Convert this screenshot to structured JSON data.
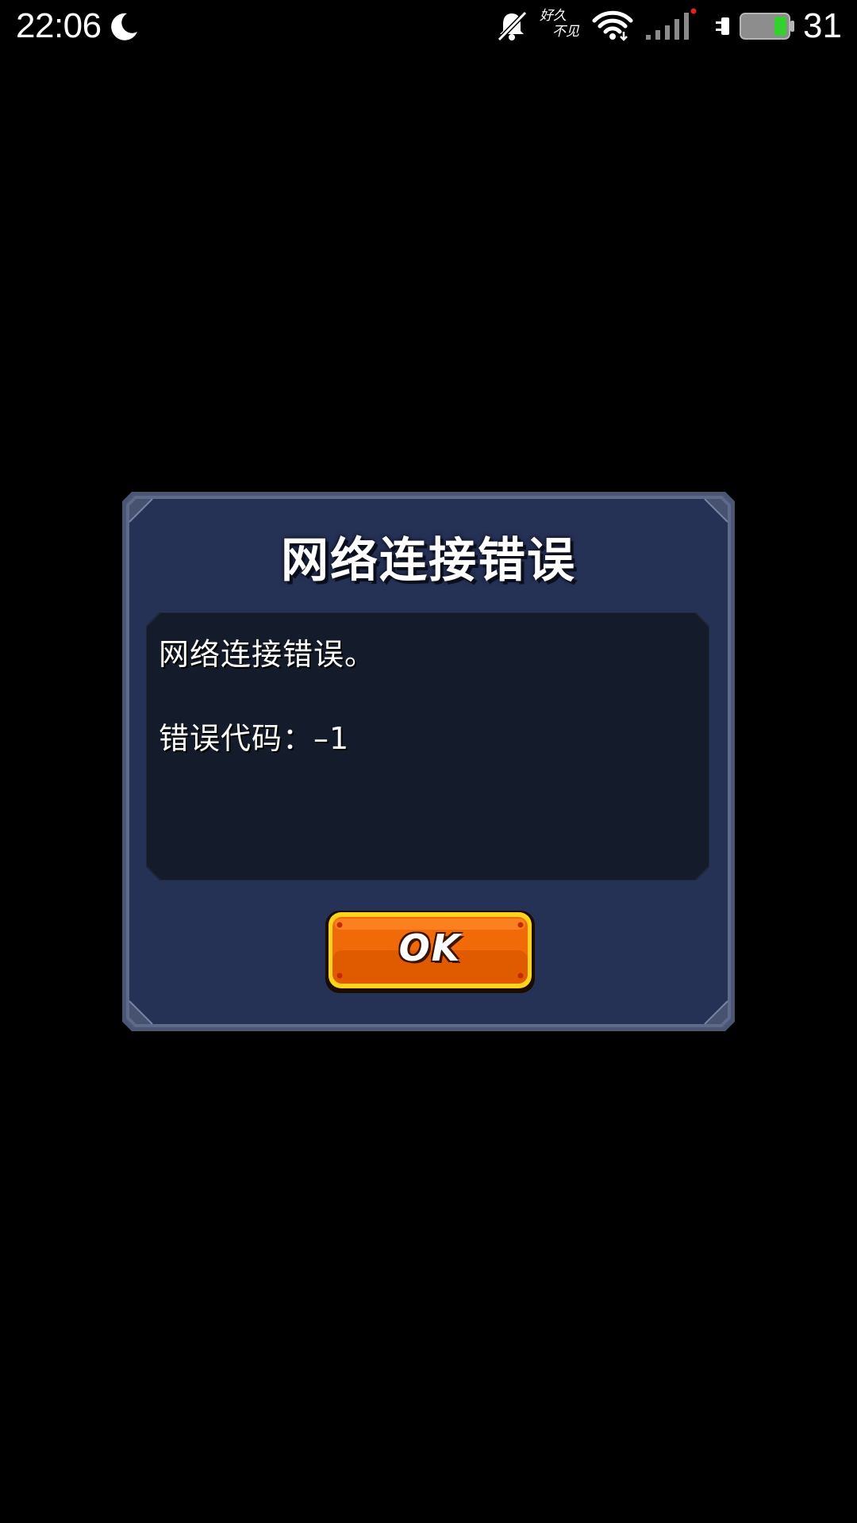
{
  "status_bar": {
    "time": "22:06",
    "carrier_line1": "好久",
    "carrier_line2": "不见",
    "battery_level": "31",
    "icons": [
      "moon-icon",
      "bell-muted-icon",
      "wifi-icon",
      "signal-icon",
      "charging-plug-icon",
      "battery-icon"
    ]
  },
  "dialog": {
    "title": "网络连接错误",
    "message_line1": "网络连接错误。",
    "message_line2": "错误代码：–1",
    "ok_label": "OK"
  },
  "colors": {
    "background": "#000000",
    "dialog_bg": "#263156",
    "message_bg": "#141b2a",
    "button_orange": "#f06a0a",
    "button_border": "#ffd21e",
    "battery_fill": "#33d12e"
  }
}
